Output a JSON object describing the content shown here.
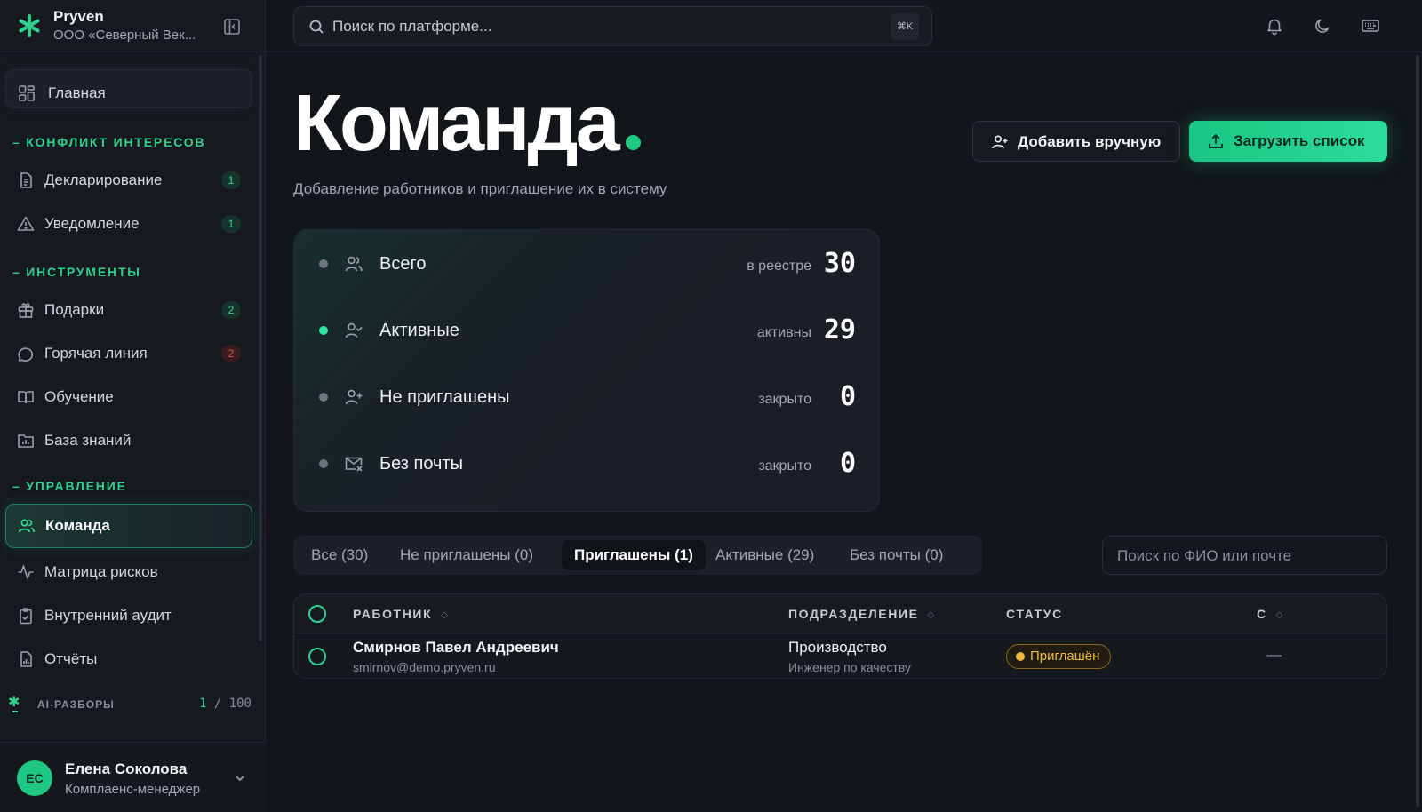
{
  "brand": {
    "name": "Pryven",
    "org": "ООО «Северный Век..."
  },
  "sidebar": {
    "home": "Главная",
    "sections": {
      "conflict": "КОНФЛИКТ ИНТЕРЕСОВ",
      "tools": "ИНСТРУМЕНТЫ",
      "management": "УПРАВЛЕНИЕ"
    },
    "items": {
      "declaring": {
        "label": "Декларирование",
        "badge": "1"
      },
      "notification": {
        "label": "Уведомление",
        "badge": "1"
      },
      "gifts": {
        "label": "Подарки",
        "badge": "2"
      },
      "hotline": {
        "label": "Горячая линия",
        "badge": "2"
      },
      "training": {
        "label": "Обучение"
      },
      "knowledge": {
        "label": "База знаний"
      },
      "team": {
        "label": "Команда"
      },
      "risk": {
        "label": "Матрица рисков"
      },
      "audit": {
        "label": "Внутренний аудит"
      },
      "reports": {
        "label": "Отчёты"
      }
    },
    "ai": {
      "label": "AI-РАЗБОРЫ",
      "used": "1",
      "separator": "/",
      "limit": "100"
    },
    "user": {
      "initials": "ЕС",
      "name": "Елена Соколова",
      "role": "Комплаенс-менеджер"
    }
  },
  "topbar": {
    "search_placeholder": "Поиск по платформе...",
    "shortcut": "⌘K"
  },
  "page": {
    "title": "Команда",
    "subtitle": "Добавление работников и приглашение их в систему",
    "btn_add": "Добавить вручную",
    "btn_upload": "Загрузить список"
  },
  "stats": [
    {
      "label": "Всего",
      "note": "в реестре",
      "value": "30"
    },
    {
      "label": "Активные",
      "note": "активны",
      "value": "29"
    },
    {
      "label": "Не приглашены",
      "note": "закрыто",
      "value": "0"
    },
    {
      "label": "Без почты",
      "note": "закрыто",
      "value": "0"
    }
  ],
  "tabs": [
    "Все (30)",
    "Не приглашены (0)",
    "Приглашены (1)",
    "Активные (29)",
    "Без почты (0)"
  ],
  "table_search_placeholder": "Поиск по ФИО или почте",
  "table": {
    "headers": {
      "employee": "РАБОТНИК",
      "department": "ПОДРАЗДЕЛЕНИЕ",
      "status": "СТАТУС",
      "since": "С"
    },
    "rows": [
      {
        "name": "Смирнов Павел Андреевич",
        "email": "smirnov@demo.pryven.ru",
        "department": "Производство",
        "position": "Инженер по качеству",
        "status": "Приглашён",
        "since": "—"
      }
    ]
  },
  "colors": {
    "accent": "#1fca85",
    "status_invited": "#f1b83a",
    "badge_red": "#e2575f"
  }
}
